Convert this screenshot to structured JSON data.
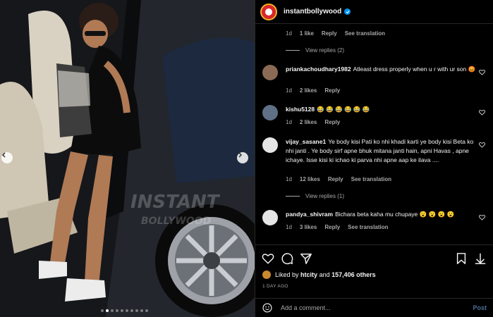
{
  "post": {
    "username": "instantbollywood",
    "watermark": "INSTANT BOLLYWOOD",
    "carousel": {
      "total": 10,
      "active": 2
    }
  },
  "top_comment_meta": {
    "time": "1d",
    "likes": "1 like",
    "reply": "Reply",
    "translate": "See translation"
  },
  "view_replies_1": "View replies (2)",
  "comments": [
    {
      "username": "priankachoudhary1982",
      "text": "Atleast dress properly when u r with ur son",
      "emoji": "😡",
      "time": "1d",
      "likes": "2 likes",
      "reply": "Reply",
      "translate": ""
    },
    {
      "username": "kishu5128",
      "text": "",
      "emoji": "😂 😂 😂 😂 😂 😂",
      "time": "1d",
      "likes": "2 likes",
      "reply": "Reply",
      "translate": ""
    },
    {
      "username": "vijay_sasane1",
      "text": "Ye body kisi Pati ko nhi khadi karti ye body kisi Beta ko nhi janti . Ye body sirf apne bhuk mitana janti hain, apni Havas , apne ichaye. Isse kisi ki ichao ki parva nhi apne aap ke ilava ....",
      "emoji": "",
      "time": "1d",
      "likes": "12 likes",
      "reply": "Reply",
      "translate": "See translation"
    },
    {
      "username": "pandya_shivram",
      "text": "Bichara beta kaha mu chupaye",
      "emoji": "😮 😮 😮 😮",
      "time": "1d",
      "likes": "3 likes",
      "reply": "Reply",
      "translate": "See translation"
    }
  ],
  "view_replies_2": "View replies (1)",
  "likes": {
    "prefix": "Liked by",
    "user": "htcity",
    "and": "and",
    "count": "157,406 others"
  },
  "posted_ago": "1 DAY AGO",
  "add_comment": {
    "placeholder": "Add a comment...",
    "post_label": "Post"
  },
  "colors": {
    "link": "#4c6d96",
    "verified": "#0095f6",
    "meta": "#a8a8a8"
  }
}
